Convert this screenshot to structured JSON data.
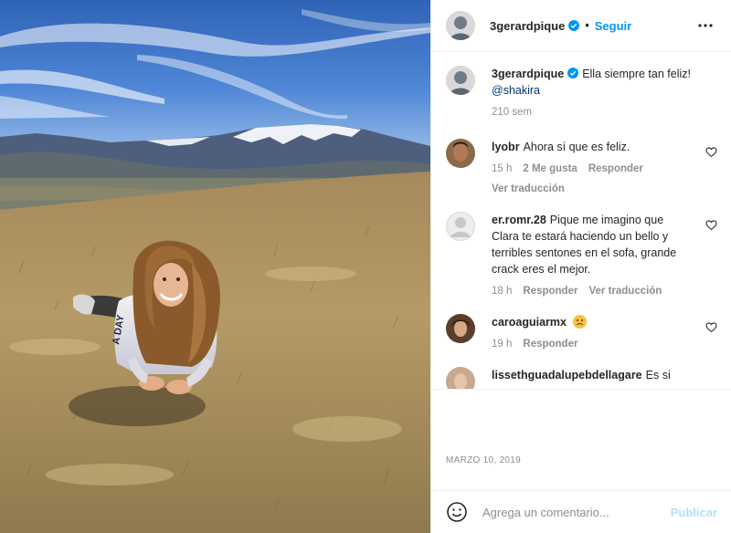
{
  "post": {
    "image_alt": "",
    "author": "3gerardpique",
    "verified": true,
    "follow_label": "Seguir",
    "separator": "•"
  },
  "caption": {
    "username": "3gerardpique",
    "text": "Ella siempre tan feliz!",
    "mention": "@shakira",
    "time": "210 sem"
  },
  "comments": [
    {
      "username": "lyobr",
      "text": "Ahora sí que es feliz.",
      "time": "15 h",
      "likes": "2 Me gusta",
      "reply_label": "Responder",
      "translate_label": "Ver traducción"
    },
    {
      "username": "er.romr.28",
      "text": "Pique me imagino que Clara te estará haciendo un bello y terribles sentones en el sofa, grande crack eres el mejor.",
      "time": "18 h",
      "reply_label": "Responder",
      "translate_label": "Ver traducción"
    },
    {
      "username": "caroaguiarmx",
      "text": "",
      "emoji": "sad-face-emoji",
      "time": "19 h",
      "reply_label": "Responder"
    },
    {
      "username": "lissethguadalupebdellagare",
      "text": "Es si"
    }
  ],
  "footer": {
    "date": "MARZO 10, 2019",
    "comment_placeholder": "Agrega un comentario...",
    "publish_label": "Publicar"
  },
  "colors": {
    "accent": "#0095f6",
    "publish_disabled": "#b2dffc",
    "secondary_text": "#8e8e8e",
    "primary_text": "#262626",
    "divider": "#efefef"
  },
  "icons": [
    "verified-badge-icon",
    "more-options-icon",
    "heart-icon",
    "emoji-icon"
  ]
}
